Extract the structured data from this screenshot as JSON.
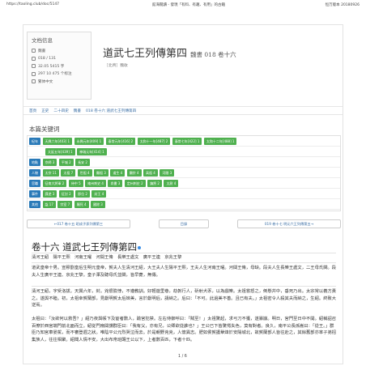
{
  "browser": {
    "url": "https://taoling.club/doc/5147",
    "page_title": "館海閱讀 - 發現「有料、有趣、有用」的古籍",
    "version": "恒万版本 20180926"
  },
  "info": {
    "title": "文档信息",
    "rows": [
      {
        "icon": "book-icon",
        "text": "魏書"
      },
      {
        "icon": "volume-icon",
        "text": "018 / 131"
      },
      {
        "icon": "characters-icon",
        "text": "32.05 5415 字"
      },
      {
        "icon": "reads-icon",
        "text": "297 10 475 个标注"
      },
      {
        "icon": "tag-icon",
        "text": "繁体中文"
      }
    ]
  },
  "doc": {
    "title": "道武七王列傳第四",
    "subtitle": "魏書 018 卷十六",
    "author": "［北齊］魏收"
  },
  "breadcrumb": [
    "首頁",
    "正史",
    "二十四史",
    "魏書",
    "018 卷十六 道武七王列傳第四"
  ],
  "keywords": {
    "title": "本篇关键词",
    "rows": [
      {
        "category": "紀年",
        "tags": [
          "天興六年[403] 1",
          "永興元年[409] 1",
          "泰常元年[416] 2",
          "太和十一年[487] 2",
          "泰常七年[422] 1",
          "太和十二年[488] 1"
        ]
      },
      {
        "category": "",
        "tags": [
          "太延五年[439] 1",
          "神瑞元年[414] 1"
        ]
      },
      {
        "category": "地點",
        "tags": [
          "京師 3",
          "平城 2",
          "長安 2"
        ]
      },
      {
        "category": "人物",
        "tags": [
          "太宗 11",
          "太祖 7",
          "世祖 4",
          "顯祖 3",
          "道生 4",
          "顯宗 4",
          "高祖 4",
          "河間 3"
        ]
      },
      {
        "category": "官職",
        "tags": [
          "征南大將軍 2",
          "侍中 5",
          "雍州刺史 4",
          "尚書 3",
          "定州刺史 2",
          "鎮將 2",
          "太尉 4"
        ]
      },
      {
        "category": "事件",
        "tags": [
          "謀逆 3",
          "征討 2",
          "即位 2",
          "封王 4"
        ]
      },
      {
        "category": "其他",
        "tags": [
          "諡 17",
          "宗室 7",
          "賜死 4",
          "國除 3"
        ]
      }
    ]
  },
  "nav": {
    "prev": "←017 卷十五 昭成子孫列傳第三",
    "toc": "目錄",
    "next": "019 卷十七 明元六王列傳第五→"
  },
  "chapter": {
    "heading": "卷十六 道武七王列傳第四",
    "roster": "清河王紹　陽平王熙　河南王曜　河間王脩　長樂王處文　廣平王連　京兆王黎",
    "para1": "道武皇帝十男。宣穆劉皇后生明元皇帝，賀夫人生清河王紹，大王夫人生陽平王熙，王夫人生河南王曜。河間王脩，母缺。段夫人生長樂王處文，二王母氏闕。段夫人生廣平王連、京兆王黎。皇子渾及聰母氏並闕，皆早薨，無傳。",
    "para2": "清河王紹，字受洛拔。天興六年，封。兇很險悖，不遵教訓。好輕遊里巷，劫剝行人，斫射犬豕，以為戲樂。太祖嘗怒之，倒懸井中，垂死乃出。太宗常以義方責之，遂與不睦。初，太祖幸賀蘭部，見獻明賀太后妹美，言於獻明后，請納之。后曰：「不可。此過美不善。且已有夫。」太祖密令人殺其夫而納之，生紹。終致大逆焉。",
    "para3": "太祖曰：「汝欲何以救吾？」紹乃夜與帳下及宦者數人，踰宮犯禁。左右侍御呼曰：「賊至！」太祖驚起，求弓刀不獲，遂暴崩。明日，宮門至日中不開。紹稱詔召百僚於西宮端門前北面而立。紹從門扇間謂群臣曰：「我有父，亦有兄，公卿欲從誰也？」王公已下皆驚愕失色，莫有對者。良久，南平公長孫嵩曰：「從王。」群臣乃知宮車晏駕，而不審登遐之狀。唯陰平公元烈哭泣而去。於是朝野兇兇，人懷異志。肥如侯賀護舉烽於安陽城北，故賀蘭部人皆往赴之，其餘舊部亦率子弟招集族人，往往相聚。紹聞人情不安，大出布帛班賜王公以下，上者數百匹，下者十匹。"
  },
  "pager": "1 / 6"
}
